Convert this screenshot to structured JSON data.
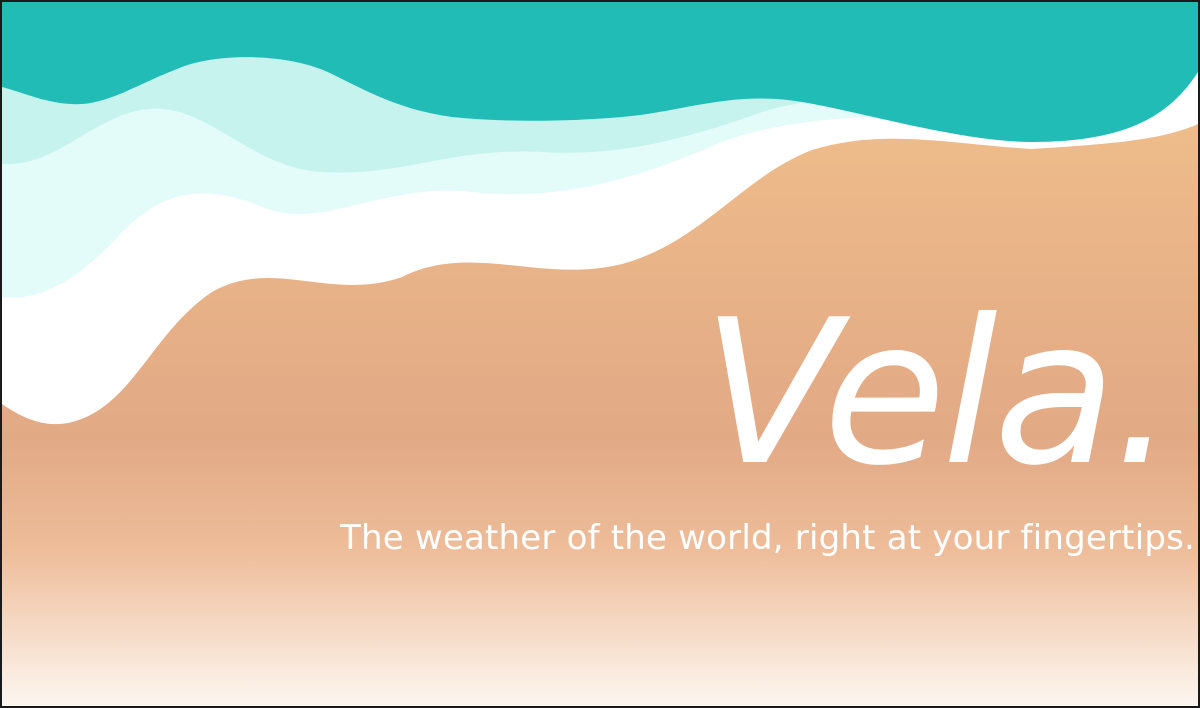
{
  "hero": {
    "title": "Vela.",
    "tagline": "The weather of the world, right at your fingertips."
  },
  "colors": {
    "sea": "#22bcb6",
    "shallow_water": "#c6f3ee",
    "foam_light": "#e3fbf9",
    "foam": "#ffffff",
    "sand_top": "#f3c38d",
    "sand_mid": "#e2a985",
    "sand_bottom": "#fdf6f0",
    "text": "#ffffff"
  }
}
